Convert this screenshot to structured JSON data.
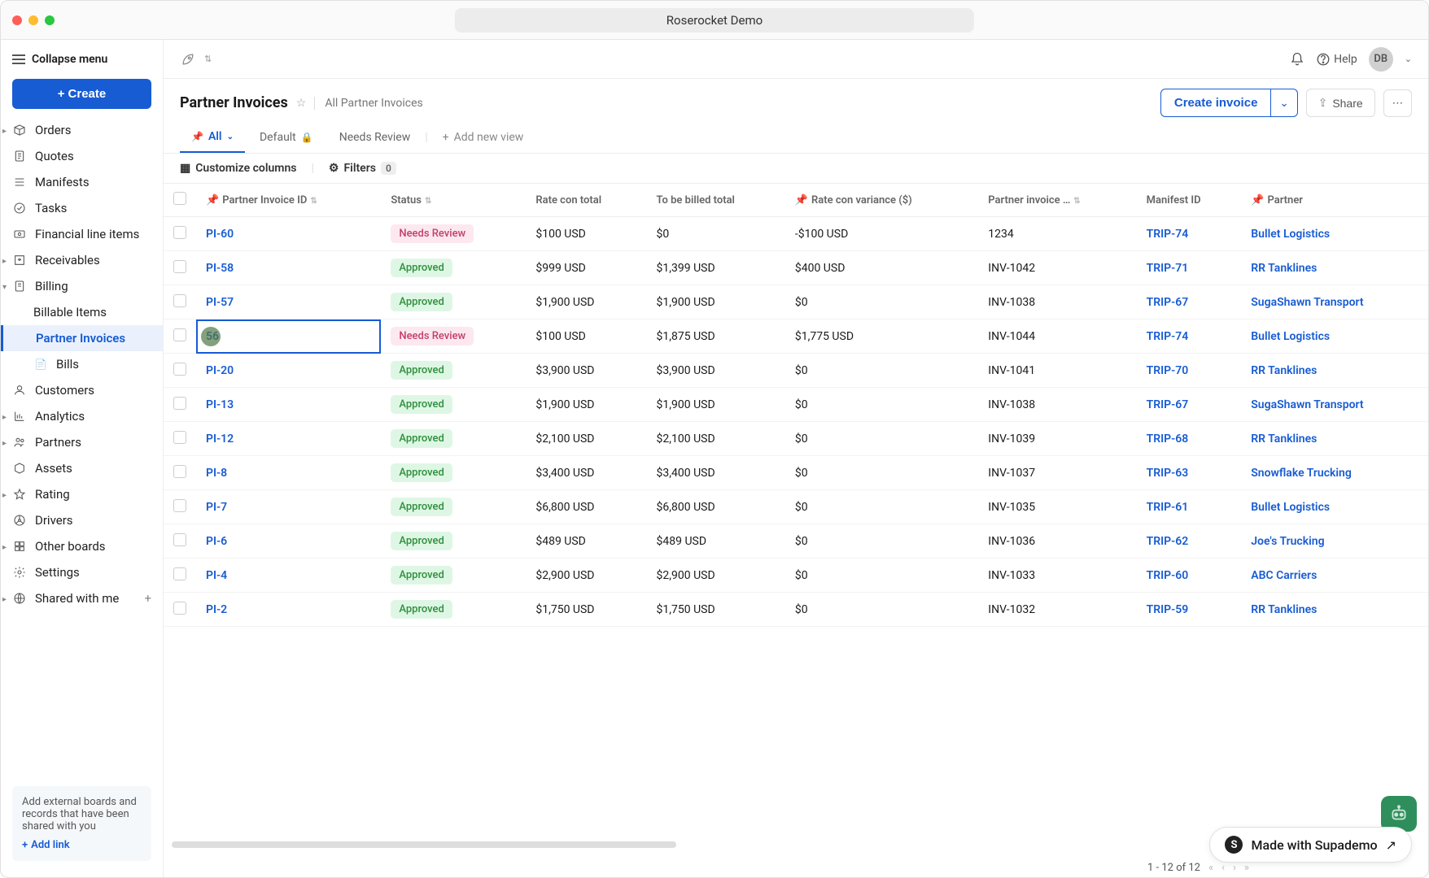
{
  "window_title": "Roserocket Demo",
  "sidebar": {
    "collapse": "Collapse menu",
    "create": "Create",
    "items": [
      {
        "label": "Orders",
        "icon": "box"
      },
      {
        "label": "Quotes",
        "icon": "doc"
      },
      {
        "label": "Manifests",
        "icon": "list"
      },
      {
        "label": "Tasks",
        "icon": "check"
      },
      {
        "label": "Financial line items",
        "icon": "money"
      },
      {
        "label": "Receivables",
        "icon": "in"
      },
      {
        "label": "Billing",
        "icon": "bill"
      },
      {
        "label": "Billable Items",
        "sub": true
      },
      {
        "label": "Partner Invoices",
        "sub": true,
        "active": true
      },
      {
        "label": "Bills",
        "sub": true
      },
      {
        "label": "Customers",
        "icon": "user"
      },
      {
        "label": "Analytics",
        "icon": "chart"
      },
      {
        "label": "Partners",
        "icon": "users"
      },
      {
        "label": "Assets",
        "icon": "cube"
      },
      {
        "label": "Rating",
        "icon": "star"
      },
      {
        "label": "Drivers",
        "icon": "wheel"
      },
      {
        "label": "Other boards",
        "icon": "grid"
      },
      {
        "label": "Settings",
        "icon": "gear"
      },
      {
        "label": "Shared with me",
        "icon": "globe",
        "plus": true
      }
    ],
    "shared_text": "Add external boards and records that have been shared with you",
    "add_link": "Add link"
  },
  "topbar": {
    "help": "Help",
    "avatar": "DB"
  },
  "page": {
    "title": "Partner Invoices",
    "subtitle": "All Partner Invoices",
    "create_invoice": "Create invoice",
    "share": "Share"
  },
  "views": {
    "all": "All",
    "default": "Default",
    "needs": "Needs Review",
    "add": "Add new view"
  },
  "toolbar": {
    "customize": "Customize columns",
    "filters": "Filters",
    "filter_count": "0"
  },
  "columns": [
    "",
    "Partner Invoice ID",
    "Status",
    "Rate con total",
    "To be billed total",
    "Rate con variance ($)",
    "Partner invoice …",
    "Manifest ID",
    "Partner"
  ],
  "rows": [
    {
      "id": "PI-60",
      "status": "Needs Review",
      "rct": "$100 USD",
      "tbt": "$0",
      "var": "-$100 USD",
      "pin": "1234",
      "mid": "TRIP-74",
      "partner": "Bullet Logistics"
    },
    {
      "id": "PI-58",
      "status": "Approved",
      "rct": "$999 USD",
      "tbt": "$1,399 USD",
      "var": "$400 USD",
      "pin": "INV-1042",
      "mid": "TRIP-71",
      "partner": "RR Tanklines"
    },
    {
      "id": "PI-57",
      "status": "Approved",
      "rct": "$1,900 USD",
      "tbt": "$1,900 USD",
      "var": "$0",
      "pin": "INV-1038",
      "mid": "TRIP-67",
      "partner": "SugaShawn Transport"
    },
    {
      "id": "56",
      "status": "Needs Review",
      "rct": "$100 USD",
      "tbt": "$1,875 USD",
      "var": "$1,775 USD",
      "pin": "INV-1044",
      "mid": "TRIP-74",
      "partner": "Bullet Logistics",
      "focused": true
    },
    {
      "id": "PI-20",
      "status": "Approved",
      "rct": "$3,900 USD",
      "tbt": "$3,900 USD",
      "var": "$0",
      "pin": "INV-1041",
      "mid": "TRIP-70",
      "partner": "RR Tanklines"
    },
    {
      "id": "PI-13",
      "status": "Approved",
      "rct": "$1,900 USD",
      "tbt": "$1,900 USD",
      "var": "$0",
      "pin": "INV-1038",
      "mid": "TRIP-67",
      "partner": "SugaShawn Transport"
    },
    {
      "id": "PI-12",
      "status": "Approved",
      "rct": "$2,100 USD",
      "tbt": "$2,100 USD",
      "var": "$0",
      "pin": "INV-1039",
      "mid": "TRIP-68",
      "partner": "RR Tanklines"
    },
    {
      "id": "PI-8",
      "status": "Approved",
      "rct": "$3,400 USD",
      "tbt": "$3,400 USD",
      "var": "$0",
      "pin": "INV-1037",
      "mid": "TRIP-63",
      "partner": "Snowflake Trucking"
    },
    {
      "id": "PI-7",
      "status": "Approved",
      "rct": "$6,800 USD",
      "tbt": "$6,800 USD",
      "var": "$0",
      "pin": "INV-1035",
      "mid": "TRIP-61",
      "partner": "Bullet Logistics"
    },
    {
      "id": "PI-6",
      "status": "Approved",
      "rct": "$489 USD",
      "tbt": "$489 USD",
      "var": "$0",
      "pin": "INV-1036",
      "mid": "TRIP-62",
      "partner": "Joe's Trucking"
    },
    {
      "id": "PI-4",
      "status": "Approved",
      "rct": "$2,900 USD",
      "tbt": "$2,900 USD",
      "var": "$0",
      "pin": "INV-1033",
      "mid": "TRIP-60",
      "partner": "ABC Carriers"
    },
    {
      "id": "PI-2",
      "status": "Approved",
      "rct": "$1,750 USD",
      "tbt": "$1,750 USD",
      "var": "$0",
      "pin": "INV-1032",
      "mid": "TRIP-59",
      "partner": "RR Tanklines"
    }
  ],
  "pager": "1 - 12 of 12",
  "supademo": "Made with Supademo"
}
